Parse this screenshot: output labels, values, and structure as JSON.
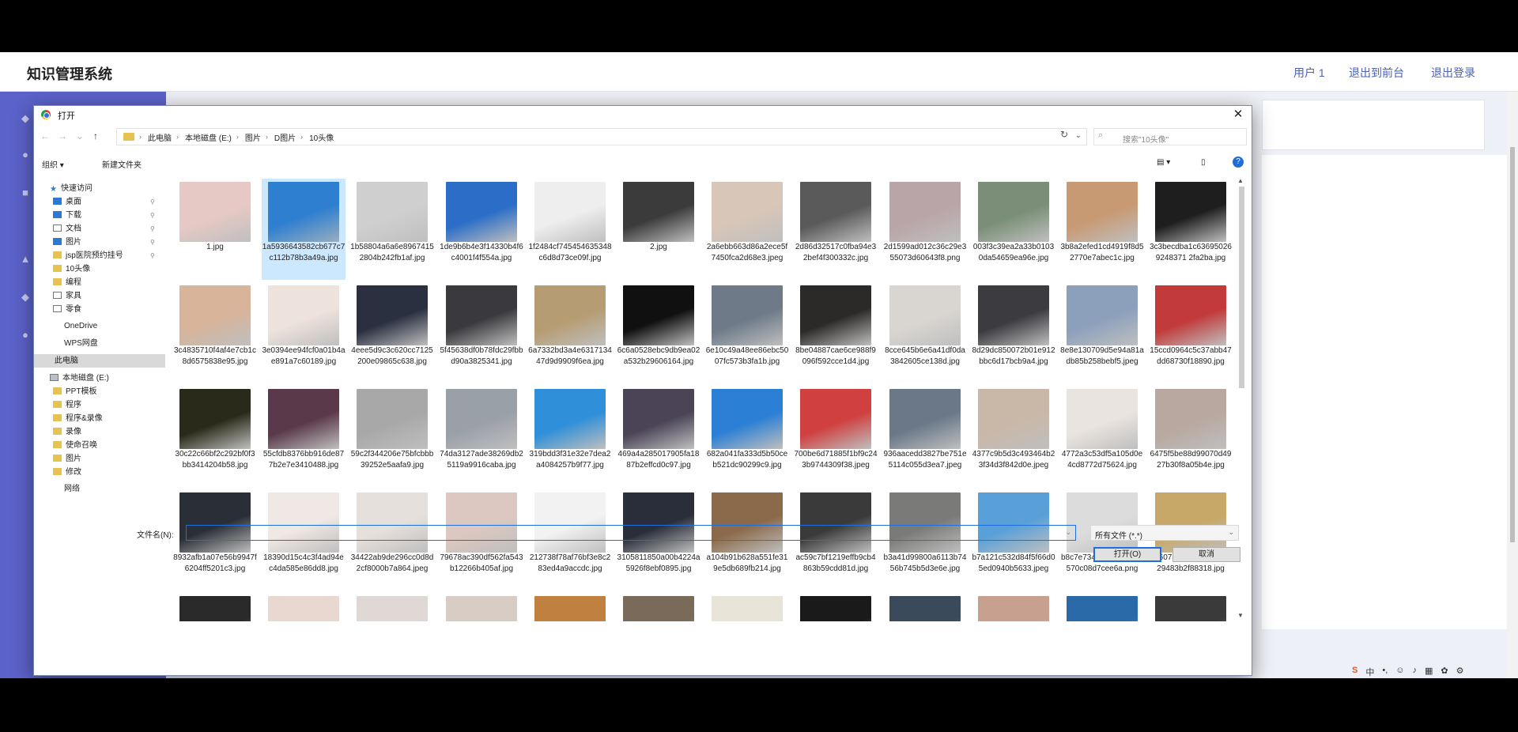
{
  "app": {
    "title": "知识管理系统",
    "header_links": [
      "用户 1",
      "退出到前台",
      "退出登录"
    ]
  },
  "dialog": {
    "title": "打开",
    "breadcrumb": [
      "此电脑",
      "本地磁盘 (E:)",
      "图片",
      "D图片",
      "10头像"
    ],
    "search_placeholder": "搜索\"10头像\"",
    "toolbar": {
      "organize": "组织 ▾",
      "new_folder": "新建文件夹"
    },
    "nav": [
      {
        "label": "快速访问",
        "icon": "star-icon"
      },
      {
        "label": "桌面",
        "icon": "desktop-icon",
        "pinned": true
      },
      {
        "label": "下载",
        "icon": "download-icon",
        "pinned": true
      },
      {
        "label": "文档",
        "icon": "document-icon",
        "pinned": true
      },
      {
        "label": "图片",
        "icon": "pictures-icon",
        "pinned": true
      },
      {
        "label": "jsp医院预约挂号",
        "icon": "folder-icon",
        "pinned": true
      },
      {
        "label": "10头像",
        "icon": "folder-icon"
      },
      {
        "label": "编程",
        "icon": "folder-icon"
      },
      {
        "label": "家具",
        "icon": "document-icon"
      },
      {
        "label": "零食",
        "icon": "document-icon"
      },
      {
        "label": "OneDrive",
        "icon": ""
      },
      {
        "label": "WPS网盘",
        "icon": ""
      },
      {
        "label": "此电脑",
        "icon": "",
        "selected": true
      },
      {
        "label": "本地磁盘 (E:)",
        "icon": "drive-icon"
      },
      {
        "label": "PPT模板",
        "icon": "folder-icon"
      },
      {
        "label": "程序",
        "icon": "folder-icon"
      },
      {
        "label": "程序&录像",
        "icon": "folder-icon"
      },
      {
        "label": "录像",
        "icon": "folder-icon"
      },
      {
        "label": "使命召唤",
        "icon": "folder-icon"
      },
      {
        "label": "图片",
        "icon": "folder-icon"
      },
      {
        "label": "修改",
        "icon": "folder-icon"
      },
      {
        "label": "网络",
        "icon": ""
      }
    ],
    "files": [
      {
        "name": "1.jpg",
        "color": "#e6c9c4"
      },
      {
        "name": "1a5936643582cb677c7c112b78b3a49a.jpg",
        "color": "#2f7fd0",
        "selected": true
      },
      {
        "name": "1b58804a6a6e89674152804b242fb1af.jpg",
        "color": "#cfcfcf"
      },
      {
        "name": "1de9b6b4e3f14330b4f6c4001f4f554a.jpg",
        "color": "#2c6ec7"
      },
      {
        "name": "1f2484cf745454635348c6d8d73ce09f.jpg",
        "color": "#eeeeee"
      },
      {
        "name": "2.jpg",
        "color": "#3b3b3b"
      },
      {
        "name": "2a6ebb663d86a2ece5f7450fca2d68e3.jpeg",
        "color": "#d8c6b8"
      },
      {
        "name": "2d86d32517c0fba94e32bef4f300332c.jpg",
        "color": "#5a5a5a"
      },
      {
        "name": "2d1599ad012c36c29e355073d60643f8.png",
        "color": "#b9a5a8"
      },
      {
        "name": "003f3c39ea2a33b01030da54659ea96e.jpg",
        "color": "#7b8f78"
      },
      {
        "name": "3b8a2efed1cd4919f8d52770e7abec1c.jpg",
        "color": "#c89a74"
      },
      {
        "name": "3c3becdba1c636950269248371 2fa2ba.jpg",
        "color": "#1e1e1e"
      },
      {
        "name": "3c4835710f4af4e7cb1c8d6575838e95.jpg",
        "color": "#d7b49a"
      },
      {
        "name": "3e0394ee94fcf0a01b4ae891a7c60189.jpg",
        "color": "#ede2dc"
      },
      {
        "name": "4eee5d9c3c620cc7125200e09865c638.jpg",
        "color": "#2a3040"
      },
      {
        "name": "5f45638df0b78fdc29fbbd90a3825341.jpg",
        "color": "#3a3a3e"
      },
      {
        "name": "6a7332bd3a4e631713447d9d9909f6ea.jpg",
        "color": "#b69c72"
      },
      {
        "name": "6c6a0528ebc9db9ea02a532b29606164.jpg",
        "color": "#101010"
      },
      {
        "name": "6e10c49a48ee86ebc5007fc573b3fa1b.jpg",
        "color": "#6e7a88"
      },
      {
        "name": "8be04887cae6ce988f9096f592cce1d4.jpg",
        "color": "#2c2a28"
      },
      {
        "name": "8cce645b6e6a41df0da3842605ce138d.jpg",
        "color": "#d9d6d2"
      },
      {
        "name": "8d29dc850072b01e912bbc6d17bcb9a4.jpg",
        "color": "#3b3b40"
      },
      {
        "name": "8e8e130709d5e94a81adb85b258bebf5.jpeg",
        "color": "#8ca0bc"
      },
      {
        "name": "15ccd0964c5c37abb47dd68730f18890.jpg",
        "color": "#c23a3a"
      },
      {
        "name": "30c22c66bf2c292bf0f3bb3414204b58.jpg",
        "color": "#2a2a1a"
      },
      {
        "name": "55cfdb8376bb916de877b2e7e3410488.jpg",
        "color": "#5a3a4a"
      },
      {
        "name": "59c2f344206e75bfcbbb39252e5aafa9.jpg",
        "color": "#a8a8a8"
      },
      {
        "name": "74da3127ade38269db25119a9916caba.jpg",
        "color": "#9aa0a8"
      },
      {
        "name": "319bdd3f31e32e7dea2a4084257b9f77.jpg",
        "color": "#2f8fd8"
      },
      {
        "name": "469a4a285017905fa1887b2effcd0c97.jpg",
        "color": "#4a4456"
      },
      {
        "name": "682a041fa333d5b50ceb521dc90299c9.jpg",
        "color": "#2b7fd5"
      },
      {
        "name": "700be6d71885f1bf9c243b9744309f38.jpeg",
        "color": "#d04040"
      },
      {
        "name": "936aacedd3827be751e5114c055d3ea7.jpeg",
        "color": "#6a7888"
      },
      {
        "name": "4377c9b5d3c493464b23f34d3f842d0e.jpeg",
        "color": "#c9b8a8"
      },
      {
        "name": "4772a3c53df5a105d0e4cd8772d75624.jpg",
        "color": "#e9e4e0"
      },
      {
        "name": "6475f5be88d99070d4927b30f8a05b4e.jpg",
        "color": "#b8a8a0"
      },
      {
        "name": "8932afb1a07e56b9947f6204ff5201c3.jpg",
        "color": "#2a2e36"
      },
      {
        "name": "18390d15c4c3f4ad94ec4da585e86dd8.jpg",
        "color": "#f0e8e4"
      },
      {
        "name": "34422ab9de296cc0d8d2cf8000b7a864.jpeg",
        "color": "#e6e0dc"
      },
      {
        "name": "79678ac390df562fa543b12266b405af.jpg",
        "color": "#dcc8c0"
      },
      {
        "name": "212738f78af76bf3e8c283ed4a9accdc.jpg",
        "color": "#f2f2f2"
      },
      {
        "name": "3105811850a00b4224a5926f8ebf0895.jpg",
        "color": "#2a2e3a"
      },
      {
        "name": "a104b91b628a551fe319e5db689fb214.jpg",
        "color": "#8a6a4a"
      },
      {
        "name": "ac59c7bf1219effb9cb4863b59cdd81d.jpg",
        "color": "#3a3a3a"
      },
      {
        "name": "b3a41d99800a6113b7456b745b5d3e6e.jpg",
        "color": "#7a7a78"
      },
      {
        "name": "b7a121c532d84f5f66d05ed0940b5633.jpeg",
        "color": "#5aa0d8"
      },
      {
        "name": "b8c7e734a9ebca0957c570c08d7cee6a.png",
        "color": "#dcdcdc"
      },
      {
        "name": "b2607a252fa93a5eda229483b2f88318.jpg",
        "color": "#c8a868"
      },
      {
        "name": "",
        "color": "#2a2a2a"
      },
      {
        "name": "",
        "color": "#e8d8d0"
      },
      {
        "name": "",
        "color": "#e0d8d4"
      },
      {
        "name": "",
        "color": "#d8ccc4"
      },
      {
        "name": "",
        "color": "#c08040"
      },
      {
        "name": "",
        "color": "#7a6a5a"
      },
      {
        "name": "",
        "color": "#e8e4d8"
      },
      {
        "name": "",
        "color": "#1a1a1a"
      },
      {
        "name": "",
        "color": "#3a4a5a"
      },
      {
        "name": "",
        "color": "#c8a090"
      },
      {
        "name": "",
        "color": "#2a6aa8"
      },
      {
        "name": "",
        "color": "#3a3a3a"
      }
    ],
    "filename_label": "文件名(N):",
    "filename_value": "",
    "filetype": "所有文件 (*.*)",
    "open_button": "打开(O)",
    "cancel_button": "取消"
  }
}
